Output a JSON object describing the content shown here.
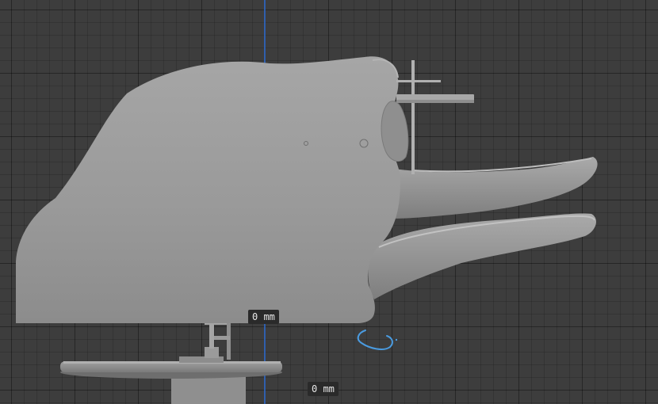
{
  "viewport": {
    "background_color": "#3d3d3d",
    "grid_color": "#2f2f2f",
    "axis_color": "#2f6fd6",
    "model_color": "#9a9a9a",
    "cursor_color": "#4a9be0"
  },
  "dimensions": {
    "label_primary": "0 mm",
    "label_secondary": "0 mm"
  },
  "icons": {
    "cursor": "rotate-cursor-icon"
  }
}
